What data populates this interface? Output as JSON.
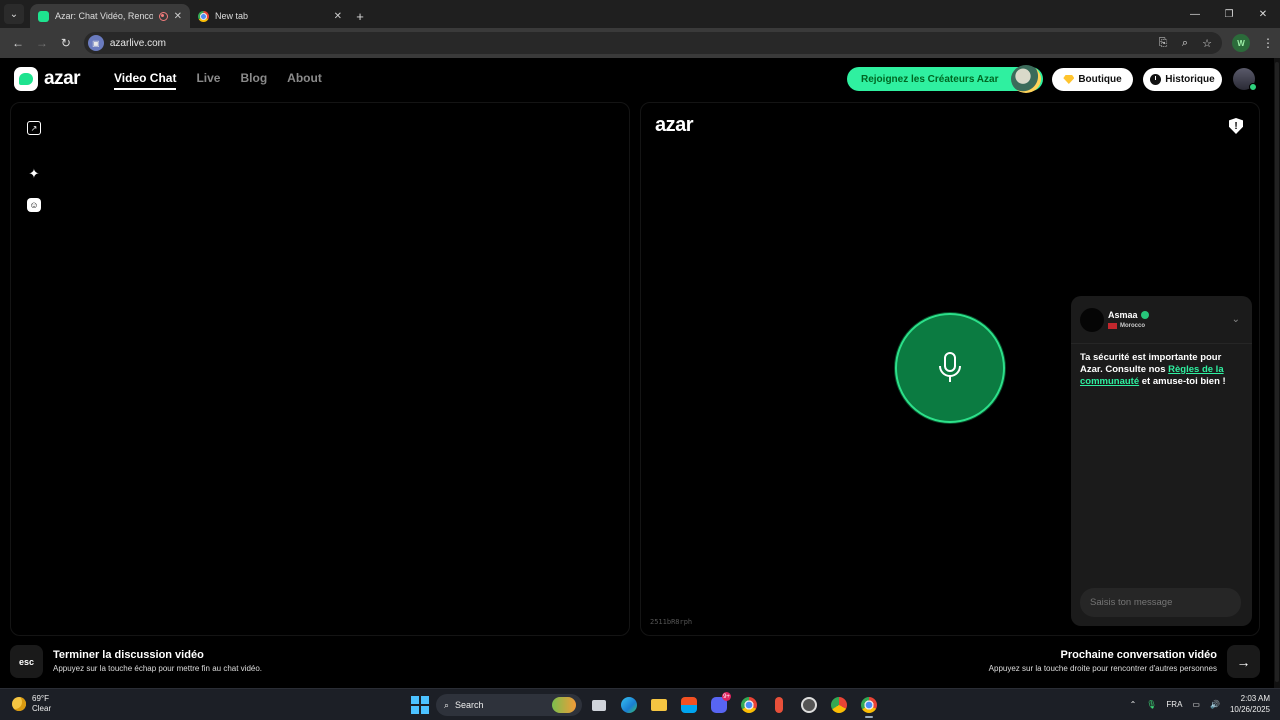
{
  "browser": {
    "tabs": [
      {
        "title": "Azar: Chat Vidéo, Rencontre",
        "active": true
      },
      {
        "title": "New tab",
        "active": false
      }
    ],
    "url": "azarlive.com",
    "profile_initial": "W"
  },
  "header": {
    "logo": "azar",
    "nav": [
      "Video Chat",
      "Live",
      "Blog",
      "About"
    ],
    "active_nav": "Video Chat",
    "creators_cta": "Rejoignez les Créateurs Azar",
    "boutique": "Boutique",
    "historique": "Historique"
  },
  "remote": {
    "logo": "azar",
    "session_id": "2511bR8rph"
  },
  "chat": {
    "partner_name": "Asmaa",
    "partner_country": "Morocco",
    "message_prefix": "Ta sécurité est importante pour Azar. Consulte nos ",
    "message_link": "Règles de la communauté",
    "message_suffix": " et amuse-toi bien !",
    "input_placeholder": "Saisis ton message"
  },
  "footer": {
    "esc_label": "esc",
    "end_title": "Terminer la discussion vidéo",
    "end_sub": "Appuyez sur la touche échap pour mettre fin au chat vidéo.",
    "next_title": "Prochaine conversation vidéo",
    "next_sub": "Appuyez sur la touche droite pour rencontrer d'autres personnes"
  },
  "taskbar": {
    "temperature": "69°F",
    "condition": "Clear",
    "search_label": "Search",
    "discord_badge": "9+",
    "language": "FRA",
    "time": "2:03 AM",
    "date": "10/26/2025"
  },
  "colors": {
    "brand_green": "#2ff0a0",
    "mic_green": "#0b7b41"
  }
}
